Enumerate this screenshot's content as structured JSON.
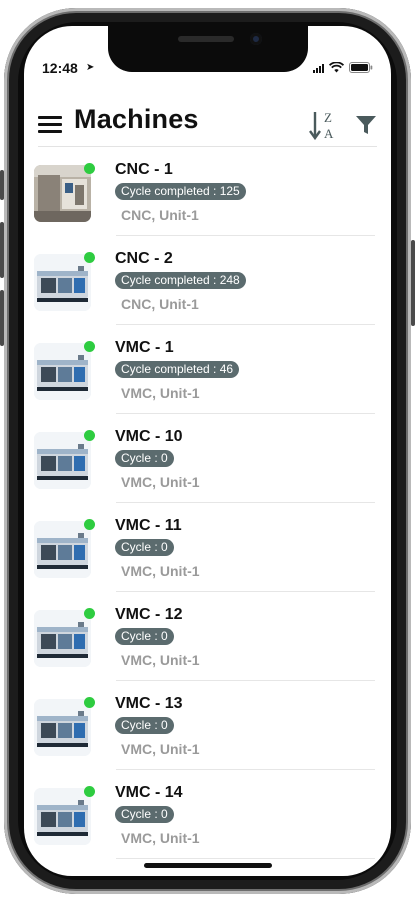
{
  "status_bar": {
    "time": "12:48",
    "location_icon": "location-arrow-icon",
    "signal_icon": "cellular-signal-icon",
    "wifi_icon": "wifi-icon",
    "battery_icon": "battery-icon"
  },
  "header": {
    "title": "Machines",
    "menu_icon": "hamburger-menu-icon",
    "sort_icon": "sort-z-a-icon",
    "filter_icon": "filter-icon"
  },
  "colors": {
    "online_dot": "#2ecc40",
    "badge_bg": "#5b6b6e",
    "subtitle": "#9a9a9a"
  },
  "machines": [
    {
      "name": "CNC - 1",
      "badge": "Cycle completed : 125",
      "subtitle": "CNC, Unit-1",
      "status": "online",
      "thumb": "photo"
    },
    {
      "name": "CNC - 2",
      "badge": "Cycle completed : 248",
      "subtitle": "CNC, Unit-1",
      "status": "online",
      "thumb": "machine"
    },
    {
      "name": "VMC - 1",
      "badge": "Cycle completed : 46",
      "subtitle": "VMC, Unit-1",
      "status": "online",
      "thumb": "machine"
    },
    {
      "name": "VMC - 10",
      "badge": "Cycle : 0",
      "subtitle": "VMC, Unit-1",
      "status": "online",
      "thumb": "machine"
    },
    {
      "name": "VMC - 11",
      "badge": "Cycle : 0",
      "subtitle": "VMC, Unit-1",
      "status": "online",
      "thumb": "machine"
    },
    {
      "name": "VMC - 12",
      "badge": "Cycle : 0",
      "subtitle": "VMC, Unit-1",
      "status": "online",
      "thumb": "machine"
    },
    {
      "name": "VMC - 13",
      "badge": "Cycle : 0",
      "subtitle": "VMC, Unit-1",
      "status": "online",
      "thumb": "machine"
    },
    {
      "name": "VMC - 14",
      "badge": "Cycle : 0",
      "subtitle": "VMC, Unit-1",
      "status": "online",
      "thumb": "machine"
    }
  ]
}
